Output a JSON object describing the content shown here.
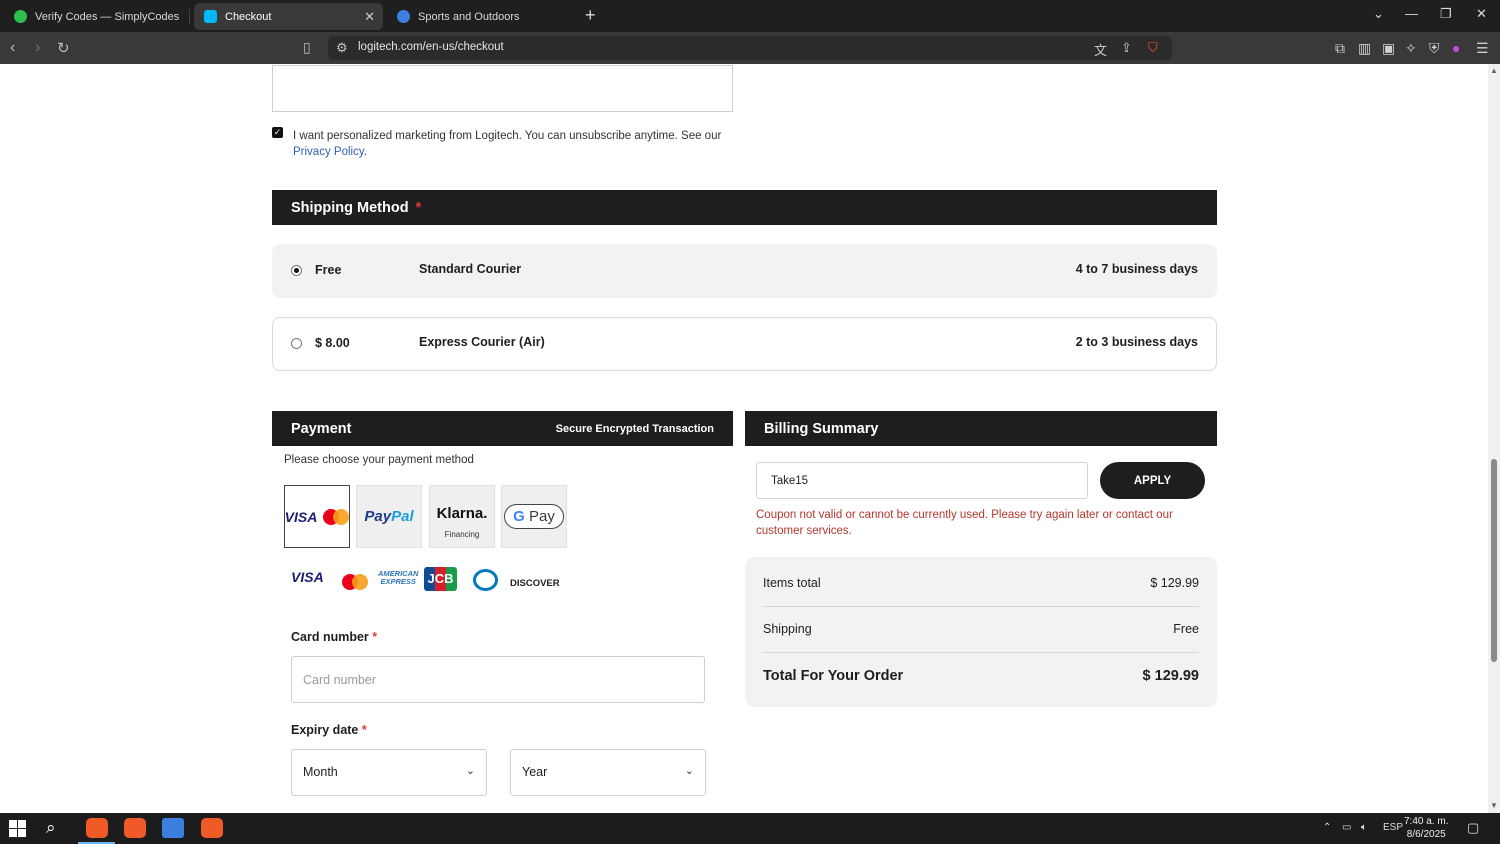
{
  "browser": {
    "tabs": [
      {
        "title": "Verify Codes — SimplyCodes",
        "favicon": "simplycodes-icon",
        "color": "#2fbf4f"
      },
      {
        "title": "Checkout",
        "favicon": "logitech-icon",
        "color": "#00b8fc"
      },
      {
        "title": "Sports and Outdoors",
        "favicon": "globe-icon",
        "color": "#3b7fe0"
      }
    ],
    "url": "logitech.com/en-us/checkout"
  },
  "page": {
    "marketing_text": "I want personalized marketing from Logitech. You can unsubscribe anytime. See our",
    "privacy_link": "Privacy Policy",
    "marketing_suffix": ".",
    "marketing_checked": true,
    "shipping": {
      "heading": "Shipping Method",
      "required_mark": "*",
      "options": [
        {
          "price": "Free",
          "name": "Standard Courier",
          "days": "4 to 7 business days",
          "selected": true
        },
        {
          "price": "$ 8.00",
          "name": "Express Courier (Air)",
          "days": "2 to 3 business days",
          "selected": false
        }
      ]
    },
    "payment": {
      "heading": "Payment",
      "secure_text": "Secure Encrypted Transaction",
      "choose_text": "Please choose your payment method",
      "methods": {
        "card_visa": "VISA",
        "paypal_pay": "Pay",
        "paypal_pal": "Pal",
        "klarna": "Klarna.",
        "klarna_sub": "Financing",
        "gpay_g": "G",
        "gpay_pay": "Pay"
      },
      "card_logos": {
        "visa": "VISA",
        "amex_line1": "AMERICAN",
        "amex_line2": "EXPRESS",
        "jcb": "JCB",
        "discover": "DISCOVER"
      },
      "card_number_label": "Card number",
      "card_number_placeholder": "Card number",
      "expiry_label": "Expiry date",
      "month_value": "Month",
      "year_value": "Year"
    },
    "billing": {
      "heading": "Billing Summary",
      "coupon_value": "Take15",
      "apply_label": "APPLY",
      "coupon_error": "Coupon not valid or cannot be currently used. Please try again later or contact our customer services.",
      "items_total_label": "Items total",
      "items_total_value": "$ 129.99",
      "shipping_label": "Shipping",
      "shipping_value": "Free",
      "total_label": "Total For Your Order",
      "total_value": "$ 129.99"
    }
  },
  "taskbar": {
    "language": "ESP",
    "time": "7:40 a. m.",
    "date": "8/6/2025"
  }
}
